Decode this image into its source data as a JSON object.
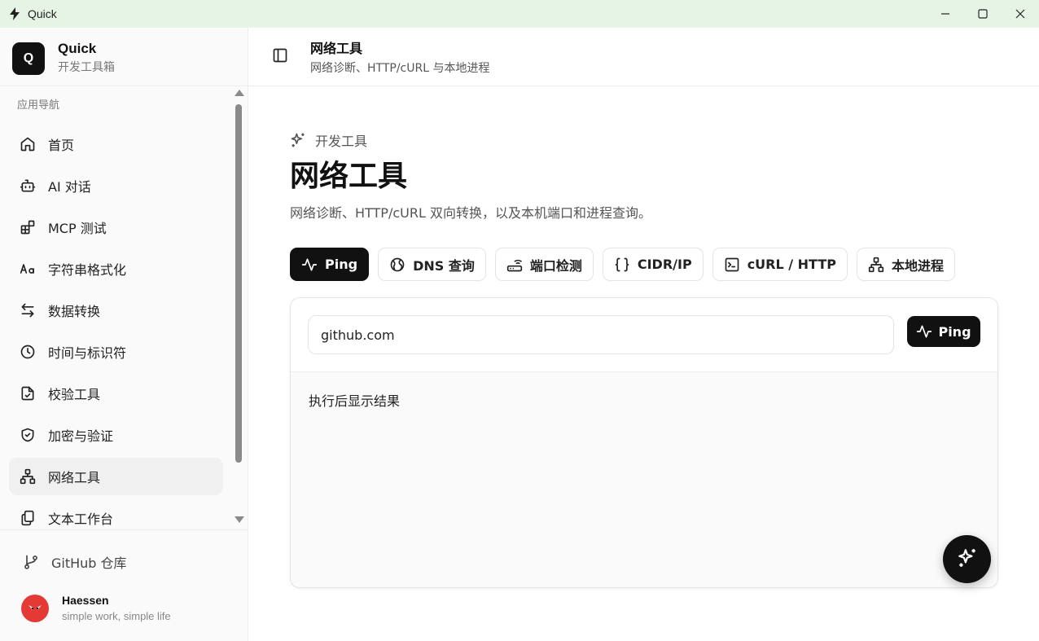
{
  "window": {
    "title": "Quick",
    "icons": {
      "app": "bolt-icon",
      "minimize": "minimize-icon",
      "maximize": "maximize-icon",
      "close": "close-icon"
    }
  },
  "brand": {
    "logo_letter": "Q",
    "name": "Quick",
    "subtitle": "开发工具箱"
  },
  "sidebar": {
    "group_label": "应用导航",
    "items": [
      {
        "label": "首页",
        "icon": "home-icon",
        "active": false
      },
      {
        "label": "AI 对话",
        "icon": "bot-icon",
        "active": false
      },
      {
        "label": "MCP 测试",
        "icon": "blocks-icon",
        "active": false
      },
      {
        "label": "字符串格式化",
        "icon": "text-case-icon",
        "active": false
      },
      {
        "label": "数据转换",
        "icon": "arrows-swap-icon",
        "active": false
      },
      {
        "label": "时间与标识符",
        "icon": "clock-icon",
        "active": false
      },
      {
        "label": "校验工具",
        "icon": "file-check-icon",
        "active": false
      },
      {
        "label": "加密与验证",
        "icon": "shield-check-icon",
        "active": false
      },
      {
        "label": "网络工具",
        "icon": "network-icon",
        "active": true
      },
      {
        "label": "文本工作台",
        "icon": "files-icon",
        "active": false
      }
    ],
    "github_label": "GitHub 仓库",
    "user": {
      "name": "Haessen",
      "tagline": "simple work, simple life"
    }
  },
  "header": {
    "title": "网络工具",
    "subtitle": "网络诊断、HTTP/cURL 与本地进程"
  },
  "main": {
    "eyebrow": "开发工具",
    "title": "网络工具",
    "description": "网络诊断、HTTP/cURL 双向转换，以及本机端口和进程查询。",
    "tabs": [
      {
        "label": "Ping",
        "icon": "activity-icon",
        "active": true
      },
      {
        "label": "DNS 查询",
        "icon": "globe-icon",
        "active": false
      },
      {
        "label": "端口检测",
        "icon": "router-icon",
        "active": false
      },
      {
        "label": "CIDR/IP",
        "icon": "braces-icon",
        "active": false
      },
      {
        "label": "cURL / HTTP",
        "icon": "terminal-icon",
        "active": false
      },
      {
        "label": "本地进程",
        "icon": "network-icon",
        "active": false
      }
    ],
    "host_input": {
      "value": "github.com",
      "placeholder": ""
    },
    "ping_button_label": "Ping",
    "result_placeholder": "执行后显示结果"
  },
  "colors": {
    "accent": "#111111",
    "titlebar_bg": "#e6f4e6",
    "avatar_bg": "#e53935"
  }
}
